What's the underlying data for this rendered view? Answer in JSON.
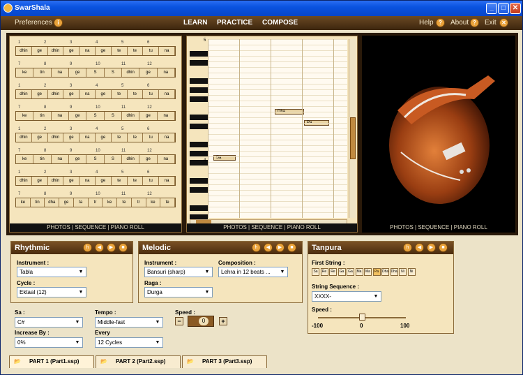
{
  "window": {
    "title": "SwarShala"
  },
  "menu": {
    "preferences": "Preferences",
    "nav": [
      "LEARN",
      "PRACTICE",
      "COMPOSE"
    ],
    "help": "Help",
    "about": "About",
    "exit": "Exit"
  },
  "pane_links": "PHOTOS | SEQUENCE | PIANO ROLL",
  "tabla_rows": [
    {
      "nums": [
        "1",
        "2",
        "3",
        "4",
        "5",
        "6"
      ],
      "bols": [
        "dhin",
        "ge",
        "dhin",
        "ge",
        "na",
        "ge",
        "te",
        "te",
        "tu",
        "na"
      ]
    },
    {
      "nums": [
        "7",
        "8",
        "9",
        "10",
        "11",
        "12"
      ],
      "bols": [
        "ke",
        "tin",
        "na",
        "ge",
        "S",
        "S",
        "dhin",
        "ge",
        "na"
      ]
    },
    {
      "nums": [
        "1",
        "2",
        "3",
        "4",
        "5",
        "6"
      ],
      "bols": [
        "dhin",
        "ge",
        "dhin",
        "ge",
        "na",
        "ge",
        "te",
        "te",
        "tu",
        "na"
      ]
    },
    {
      "nums": [
        "7",
        "8",
        "9",
        "10",
        "11",
        "12"
      ],
      "bols": [
        "ke",
        "tin",
        "na",
        "ge",
        "S",
        "S",
        "dhin",
        "ge",
        "na"
      ]
    },
    {
      "nums": [
        "1",
        "2",
        "3",
        "4",
        "5",
        "6"
      ],
      "bols": [
        "dhin",
        "ge",
        "dhin",
        "ge",
        "na",
        "ge",
        "te",
        "te",
        "tu",
        "na"
      ]
    },
    {
      "nums": [
        "7",
        "8",
        "9",
        "10",
        "11",
        "12"
      ],
      "bols": [
        "ke",
        "tin",
        "na",
        "ge",
        "S",
        "S",
        "dhin",
        "ge",
        "na"
      ]
    },
    {
      "nums": [
        "1",
        "2",
        "3",
        "4",
        "5",
        "6"
      ],
      "bols": [
        "dhin",
        "ge",
        "dhin",
        "ge",
        "na",
        "ge",
        "te",
        "te",
        "tu",
        "na"
      ]
    },
    {
      "nums": [
        "7",
        "8",
        "9",
        "10",
        "11",
        "12"
      ],
      "bols": [
        "ke",
        "tin",
        "dha",
        "ge",
        "ta",
        "tr",
        "ke",
        "te",
        "tr",
        "ke",
        "te"
      ]
    }
  ],
  "piano": {
    "octave_labels": [
      "5",
      "5",
      "4"
    ],
    "notes": [
      "Dha",
      "Pa",
      "Sa"
    ]
  },
  "rhythmic": {
    "title": "Rhythmic",
    "instrument_label": "Instrument :",
    "instrument": "Tabla",
    "cycle_label": "Cycle :",
    "cycle": "Ektaal (12)"
  },
  "melodic": {
    "title": "Melodic",
    "instrument_label": "Instrument :",
    "instrument": "Bansuri (sharp)",
    "composition_label": "Composition :",
    "composition": "Lehra in 12 beats ...",
    "raga_label": "Raga :",
    "raga": "Durga"
  },
  "tanpura": {
    "title": "Tanpura",
    "first_string_label": "First String :",
    "keys": [
      "Sa",
      "Re",
      "Re",
      "Ga",
      "Ga",
      "Ma",
      "Ma",
      "Pa",
      "Dha",
      "Dha",
      "Ni",
      "Ni"
    ],
    "string_sequence_label": "String Sequence :",
    "string_sequence": "XXXX-",
    "speed_label": "Speed :",
    "speed_min": "-100",
    "speed_mid": "0",
    "speed_max": "100",
    "speed_value": 0
  },
  "global": {
    "sa_label": "Sa :",
    "sa": "C#",
    "tempo_label": "Tempo :",
    "tempo": "Middle-fast",
    "speed_label": "Speed :",
    "speed_value": "0",
    "increase_label": "Increase By :",
    "increase": "0%",
    "every_label": "Every",
    "every": "12 Cycles"
  },
  "tabs": [
    "PART 1 (Part1.ssp)",
    "PART 2 (Part2.ssp)",
    "PART 3 (Part3.ssp)"
  ]
}
